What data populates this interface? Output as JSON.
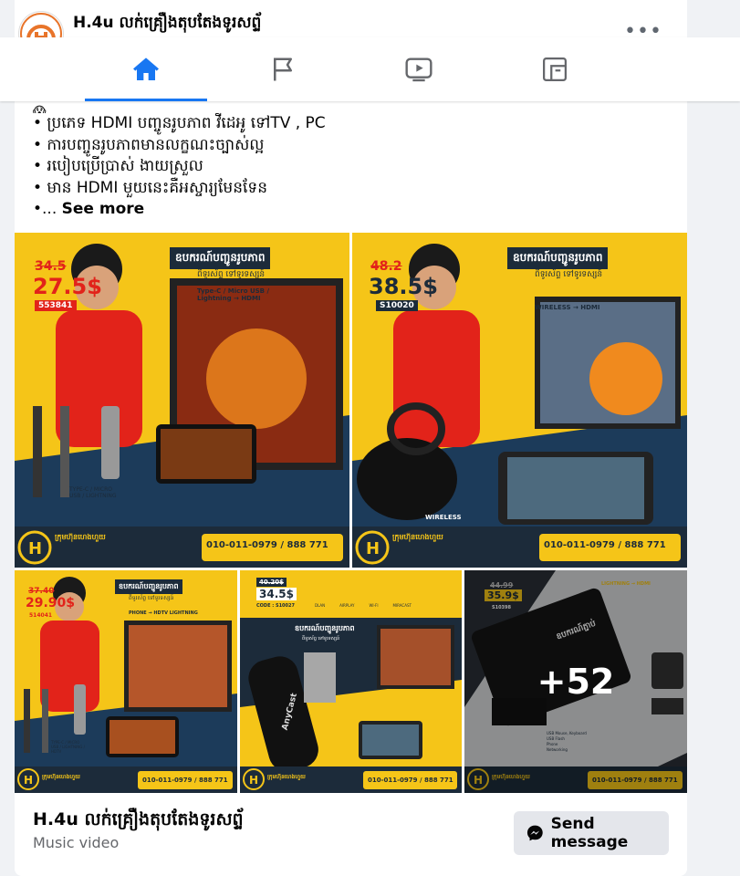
{
  "page": {
    "name": "H.4u លក់គ្រឿងតុបតែងទូរសព្ទ័",
    "category": "Music video",
    "more_label": "•••"
  },
  "nav": {
    "tabs": [
      {
        "name": "home",
        "icon": "home-icon",
        "active": true
      },
      {
        "name": "pages",
        "icon": "flag-icon",
        "active": false
      },
      {
        "name": "watch",
        "icon": "video-icon",
        "active": false
      },
      {
        "name": "feeds",
        "icon": "feeds-icon",
        "active": false
      }
    ]
  },
  "post": {
    "emoji": "😱",
    "lines": [
      "• ប្រភេទ HDMI បញ្ចូនរូបភាព វីដេអូ ទៅTV , PC",
      "• ការបញ្ចូនរូបភាពមានលក្ខណះច្បាស់ល្អ",
      "• របៀបប្រើប្រាស់ ងាយស្រួល",
      "• មាន HDMI មួយនេះគឺអស្ចារ្យមែនទែន"
    ],
    "ellipsis": "•...",
    "see_more": "See more"
  },
  "photos": [
    {
      "old_price": "34.5",
      "price": "27.5$",
      "code": "553841",
      "headline": "ឧបករណ៍បញ្ជូនរូបភាព",
      "sub": "ពីទូរស័ព្ទ ទៅទូរទស្សន៍",
      "types": "Type-C / Micro USB / Lightning → HDMI",
      "label": "TYPE-C / MICRO USB / LIGHTNING"
    },
    {
      "old_price": "48.2",
      "price": "38.5$",
      "code": "S10020",
      "headline": "ឧបករណ៍បញ្ជូនរូបភាព",
      "sub": "ពីទូរស័ព្ទ ទៅទូរទស្សន៍",
      "types": "WIRELESS → HDMI",
      "label": "WIRELESS"
    },
    {
      "old_price": "37.40",
      "price": "29.90$",
      "code": "514041",
      "headline": "ឧបករណ៍បញ្ជូនរូបភាព",
      "sub": "ពីទូរស័ព្ទ ទៅទូរទស្សន៍",
      "types": "PHONE → HDTV LIGHTNING",
      "label": "TYPE-C / MICRO USB / LIGHTNING / HDTV"
    },
    {
      "old_price": "40.20$",
      "price": "34.5$",
      "code": "CODE : S10027",
      "headline": "ឧបករណ៍បញ្ជូនរូបភាព",
      "sub": "ពីទូរស័ព្ទ ទៅទូរទស្សន៍",
      "features": [
        "DLAN",
        "AIRPLAY",
        "WI-FI",
        "MIRACAST"
      ],
      "brand": "AnyCast"
    },
    {
      "old_price": "44.99",
      "price": "35.9$",
      "code": "S10398",
      "headline": "ឧបករណ៍ភ្ជាប់",
      "sub": "LIGHTNING → HDMI",
      "features": [
        "USB Mouse, Keyboard",
        "USB Flash",
        "Phone",
        "Networking"
      ],
      "more": "+52"
    }
  ],
  "banner": {
    "shop_label": "ក្រុមហ៊ុនហេងហួយ",
    "contact_label": "ទំនាក់ទំនងលេខ",
    "phone": "010-011-0979 / 888 771"
  },
  "send_button": "Send message",
  "colors": {
    "accent": "#1877f2",
    "banner_yellow": "#f5c518",
    "banner_dark": "#1c2b3a"
  }
}
